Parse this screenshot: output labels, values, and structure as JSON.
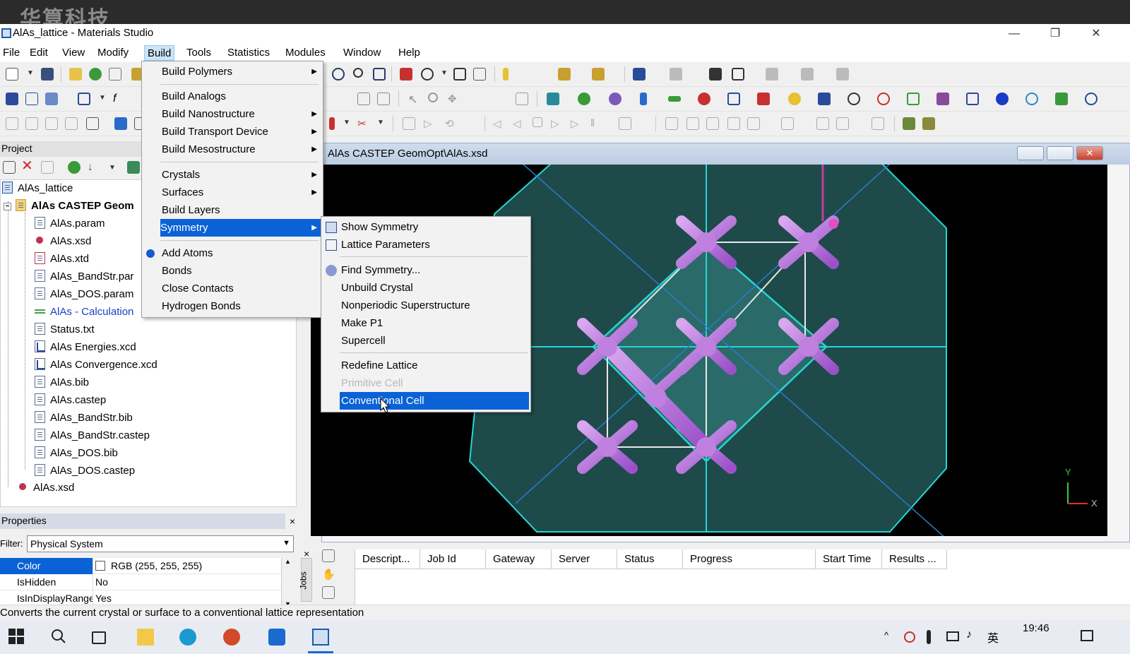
{
  "watermark": "华算科技",
  "window": {
    "title": "AlAs_lattice - Materials Studio",
    "minimize": "—",
    "restore": "❐",
    "close": "✕"
  },
  "menubar": [
    "File",
    "Edit",
    "View",
    "Modify",
    "Build",
    "Tools",
    "Statistics",
    "Modules",
    "Window",
    "Help"
  ],
  "build_menu": {
    "items": [
      "Build Polymers",
      "Build Analogs",
      "Build Nanostructure",
      "Build Transport Device",
      "Build Mesostructure",
      "Crystals",
      "Surfaces",
      "Build Layers",
      "Symmetry",
      "Add Atoms",
      "Bonds",
      "Close Contacts",
      "Hydrogen Bonds"
    ]
  },
  "symmetry_menu": {
    "items": [
      "Show Symmetry",
      "Lattice Parameters",
      "Find Symmetry...",
      "Unbuild Crystal",
      "Nonperiodic Superstructure",
      "Make P1",
      "Supercell",
      "Redefine Lattice",
      "Primitive Cell",
      "Conventional Cell"
    ]
  },
  "project": {
    "header": "Project",
    "root": "AlAs_lattice",
    "folder": "AlAs CASTEP Geom",
    "files": [
      "AlAs.param",
      "AlAs.xsd",
      "AlAs.xtd",
      "AlAs_BandStr.par",
      "AlAs_DOS.param",
      "AlAs - Calculation",
      "Status.txt",
      "AlAs Energies.xcd",
      "AlAs Convergence.xcd",
      "AlAs.bib",
      "AlAs.castep",
      "AlAs_BandStr.bib",
      "AlAs_BandStr.castep",
      "AlAs_DOS.bib",
      "AlAs_DOS.castep"
    ],
    "root_file": "AlAs.xsd"
  },
  "properties": {
    "header": "Properties",
    "close": "×",
    "filter_label": "Filter:",
    "filter_value": "Physical System",
    "rows": [
      {
        "key": "Color",
        "value": "RGB (255, 255, 255)"
      },
      {
        "key": "IsHidden",
        "value": "No"
      },
      {
        "key": "IsInDisplayRange",
        "value": "Yes"
      }
    ]
  },
  "document": {
    "title": "AlAs CASTEP GeomOpt\\AlAs.xsd",
    "axis_y": "Y",
    "axis_x": "X"
  },
  "jobs": {
    "tab_label": "Jobs",
    "close": "×",
    "columns": [
      "Descript...",
      "Job Id",
      "Gateway",
      "Server",
      "Status",
      "Progress",
      "Start Time",
      "Results ..."
    ]
  },
  "status_text": "Converts the current crystal or surface to a conventional lattice representation",
  "taskbar": {
    "time": "19:46",
    "ime": "英"
  },
  "colors": {
    "highlight": "#0a62d6",
    "cell_edge": "#26d6d6",
    "atom": "#b070d8"
  }
}
